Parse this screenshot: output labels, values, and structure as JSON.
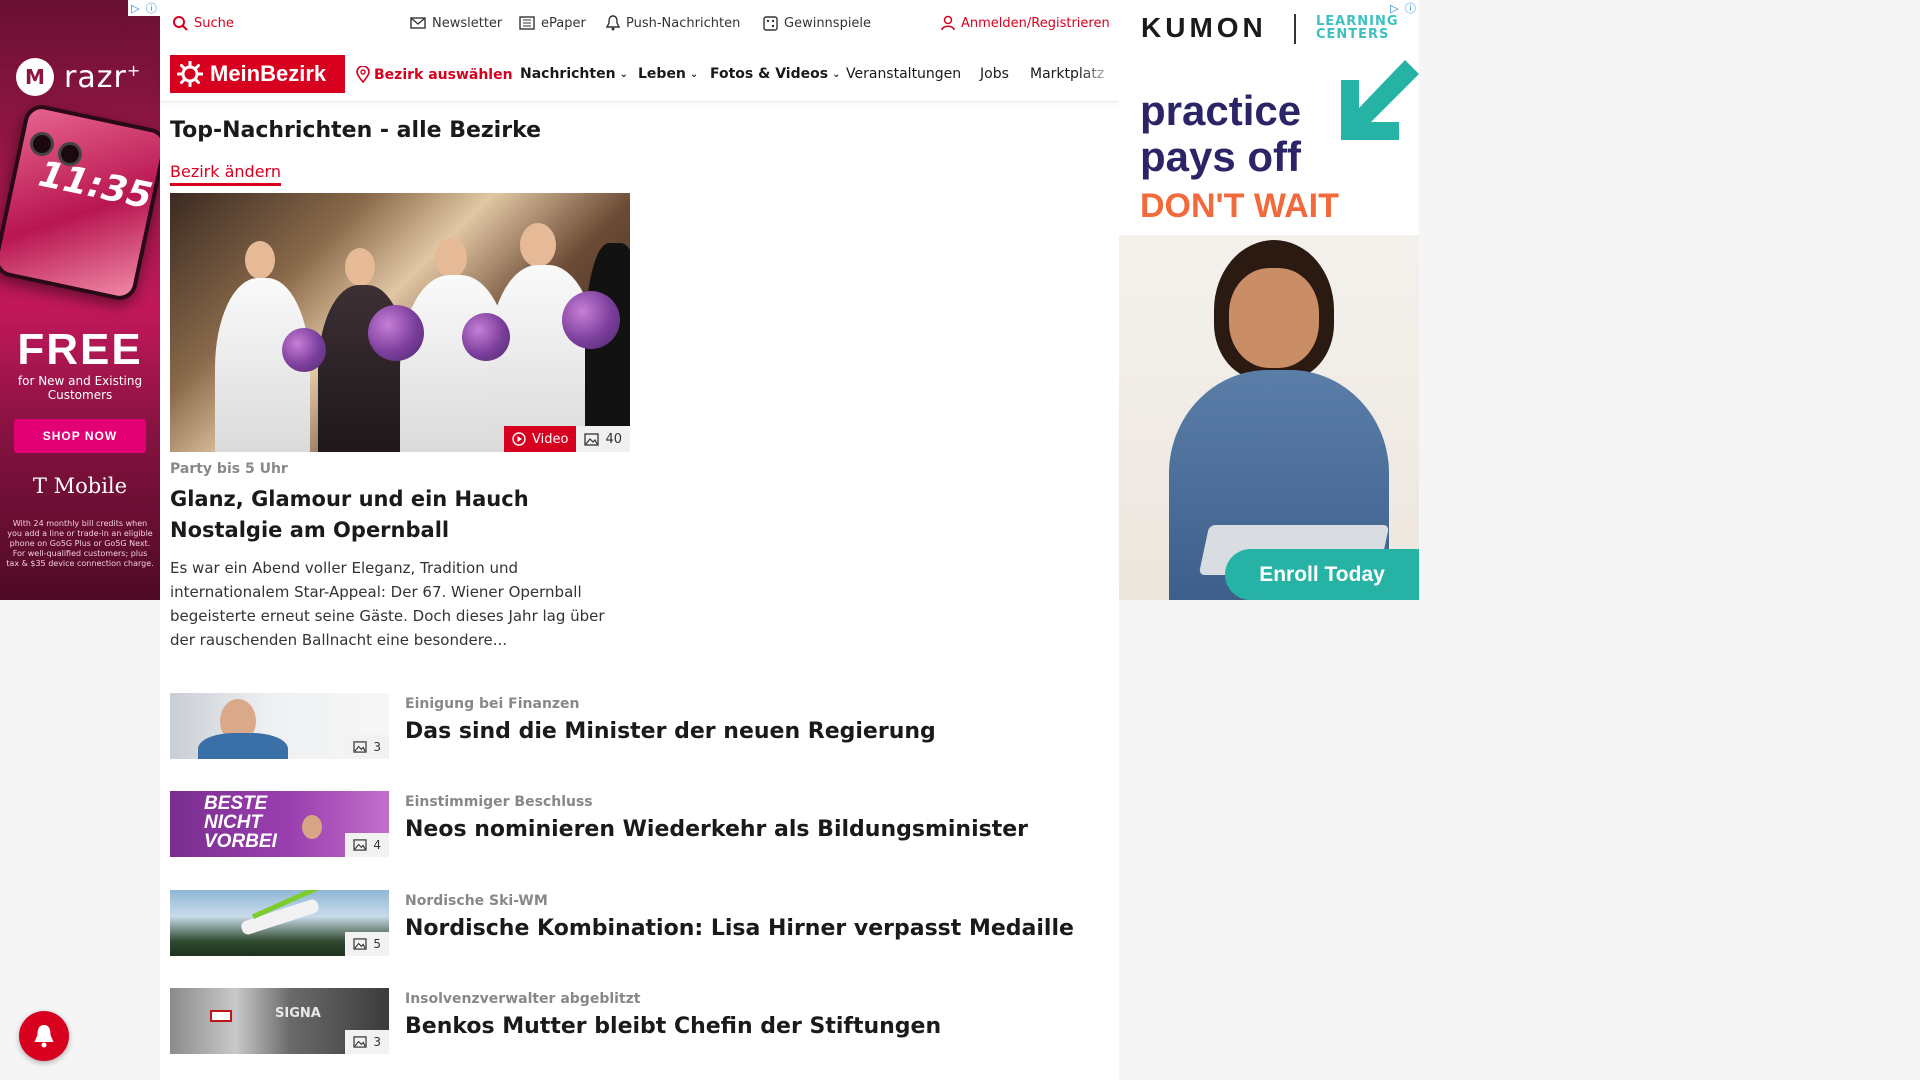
{
  "colors": {
    "brand_red": "#d8001f",
    "kumon_navy": "#2b2466",
    "kumon_teal": "#26b3a6",
    "kumon_orange": "#f26a3c"
  },
  "ad_left": {
    "brand": "razr",
    "brand_sup": "+",
    "phone_time": "11:35",
    "headline": "FREE",
    "sub": "for New and Existing Customers",
    "cta": "SHOP NOW",
    "advertiser": "T Mobile",
    "fine_print": "With 24 monthly bill credits when you add a line or trade-in an eligible phone on Go5G Plus or Go5G Next. For well-qualified customers; plus tax & $35 device connection charge."
  },
  "topbar": {
    "search": "Suche",
    "newsletter": "Newsletter",
    "epaper": "ePaper",
    "push": "Push-Nachrichten",
    "gewinnspiele": "Gewinnspiele",
    "login": "Anmelden/Registrieren"
  },
  "nav": {
    "logo": "MeinBezirk",
    "bezirk": "Bezirk auswählen",
    "items": [
      "Nachrichten",
      "Leben",
      "Fotos & Videos",
      "Veranstaltungen",
      "Jobs",
      "Marktplatz"
    ]
  },
  "section": {
    "title": "Top-Nachrichten - alle Bezirke",
    "change_link": "Bezirk ändern"
  },
  "hero": {
    "video_label": "Video",
    "photo_count": "40",
    "kicker": "Party bis 5 Uhr",
    "title": "Glanz, Glamour und ein Hauch Nostalgie am Opernball",
    "teaser": "Es war ein Abend voller Eleganz, Tradition und internationalem Star-Appeal: Der 67. Wiener Opernball begeisterte erneut seine Gäste. Doch dieses Jahr lag über der rauschenden Ballnacht eine besondere..."
  },
  "articles": [
    {
      "kicker": "Einigung bei Finanzen",
      "title": "Das sind die Minister der neuen Regierung",
      "photos": "3"
    },
    {
      "kicker": "Einstimmiger Beschluss",
      "title": "Neos nominieren Wiederkehr als Bildungsminister",
      "photos": "4",
      "thumb_text": "BESTE NICHT VORBEI"
    },
    {
      "kicker": "Nordische Ski-WM",
      "title": "Nordische Kombination: Lisa Hirner verpasst Medaille",
      "photos": "5"
    },
    {
      "kicker": "Insolvenzverwalter abgeblitzt",
      "title": "Benkos Mutter bleibt Chefin der Stiftungen",
      "photos": "3",
      "thumb_text": "SIGNA"
    }
  ],
  "ad_right": {
    "brand": "KUMON",
    "brand_sub": "LEARNING CENTERS",
    "headline": "practice pays off",
    "subhead": "DON'T WAIT",
    "cta": "Enroll Today"
  }
}
